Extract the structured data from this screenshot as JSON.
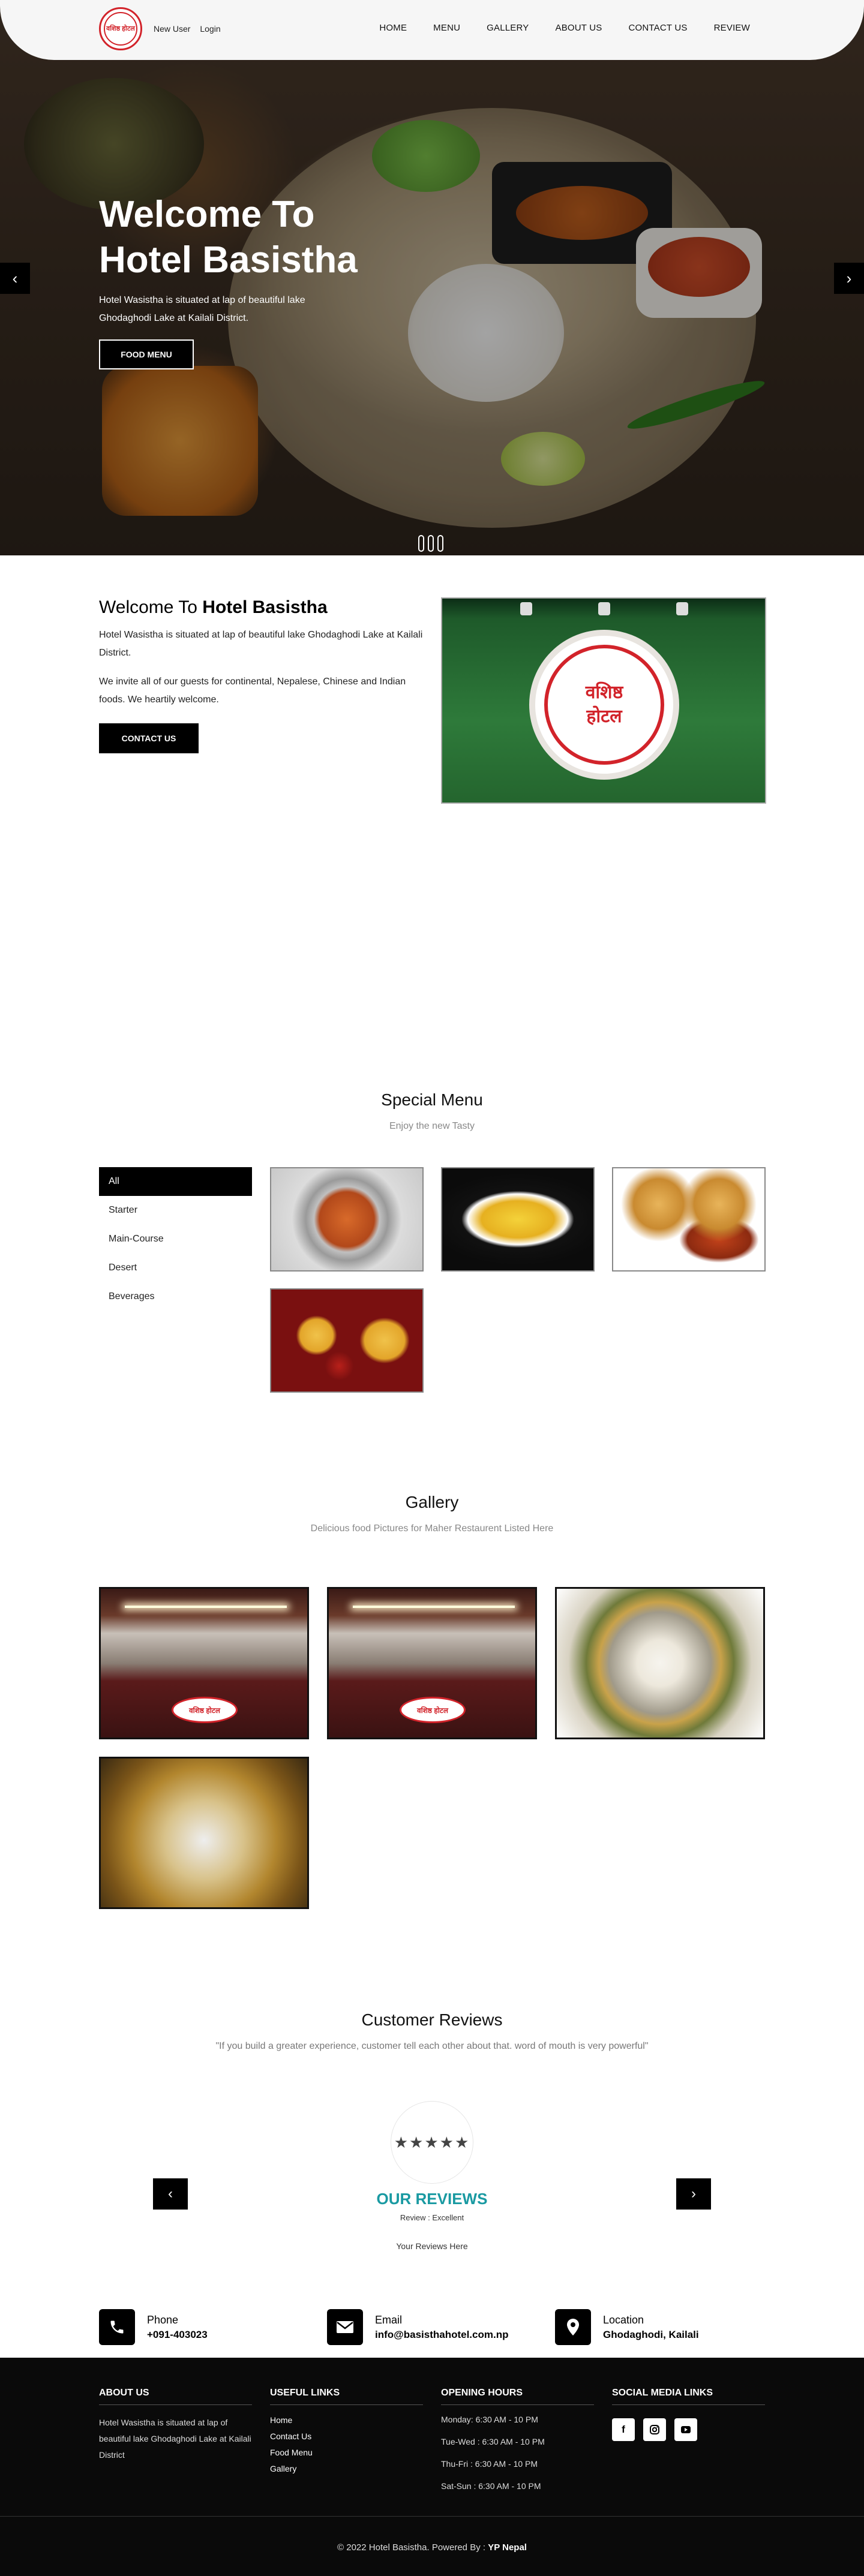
{
  "header": {
    "logo_text": "वशिष्ठ होटल",
    "new_user": "New User",
    "login": "Login",
    "nav": [
      "HOME",
      "MENU",
      "GALLERY",
      "ABOUT US",
      "CONTACT US",
      "REVIEW"
    ]
  },
  "hero": {
    "title_line1": "Welcome To",
    "title_line2": "Hotel Basistha",
    "text": "Hotel Wasistha is situated at lap of beautiful lake Ghodaghodi Lake at Kailali District.",
    "button": "FOOD MENU",
    "prev_icon": "‹",
    "next_icon": "›"
  },
  "welcome": {
    "title_prefix": "Welcome To ",
    "title_bold": "Hotel Basistha",
    "p1": "Hotel Wasistha is situated at lap of beautiful lake Ghodaghodi Lake at Kailali District.",
    "p2": "We invite all of our guests for continental, Nepalese, Chinese and Indian foods. We heartily welcome.",
    "button": "CONTACT US",
    "sign_line1": "वशिष्ठ",
    "sign_line2": "होटल"
  },
  "special_menu": {
    "title": "Special Menu",
    "subtitle": "Enjoy the new Tasty",
    "categories": [
      "All",
      "Starter",
      "Main-Course",
      "Desert",
      "Beverages"
    ],
    "active_category": "All"
  },
  "gallery": {
    "title": "Gallery",
    "subtitle": "Delicious food Pictures for Maher Restaurent Listed Here",
    "sign_text": "वशिष्ठ होटल"
  },
  "reviews": {
    "title": "Customer Reviews",
    "subtitle": "\"If you build a greater experience, customer tell each other about that. word of mouth is very powerful\"",
    "stars": "★★★★★",
    "heading": "OUR REVIEWS",
    "label": "Review : Excellent",
    "text": "Your Reviews Here",
    "prev_icon": "‹",
    "next_icon": "›"
  },
  "contact": {
    "phone_label": "Phone",
    "phone_value": "+091-403023",
    "email_label": "Email",
    "email_value": "info@basisthahotel.com.np",
    "location_label": "Location",
    "location_value": "Ghodaghodi, Kailali"
  },
  "footer": {
    "about_head": "ABOUT US",
    "about_text": "Hotel Wasistha is situated at lap of beautiful lake Ghodaghodi Lake at Kailali District",
    "links_head": "USEFUL LINKS",
    "links": [
      "Home",
      "Contact Us",
      "Food Menu",
      "Gallery"
    ],
    "hours_head": "OPENING HOURS",
    "hours": [
      "Monday: 6:30 AM - 10 PM",
      "Tue-Wed : 6:30 AM - 10 PM",
      "Thu-Fri : 6:30 AM - 10 PM",
      "Sat-Sun : 6:30 AM - 10 PM"
    ],
    "social_head": "SOCIAL MEDIA LINKS",
    "copyright": "© 2022 Hotel Basistha. Powered By : ",
    "powered_by": "YP Nepal"
  }
}
